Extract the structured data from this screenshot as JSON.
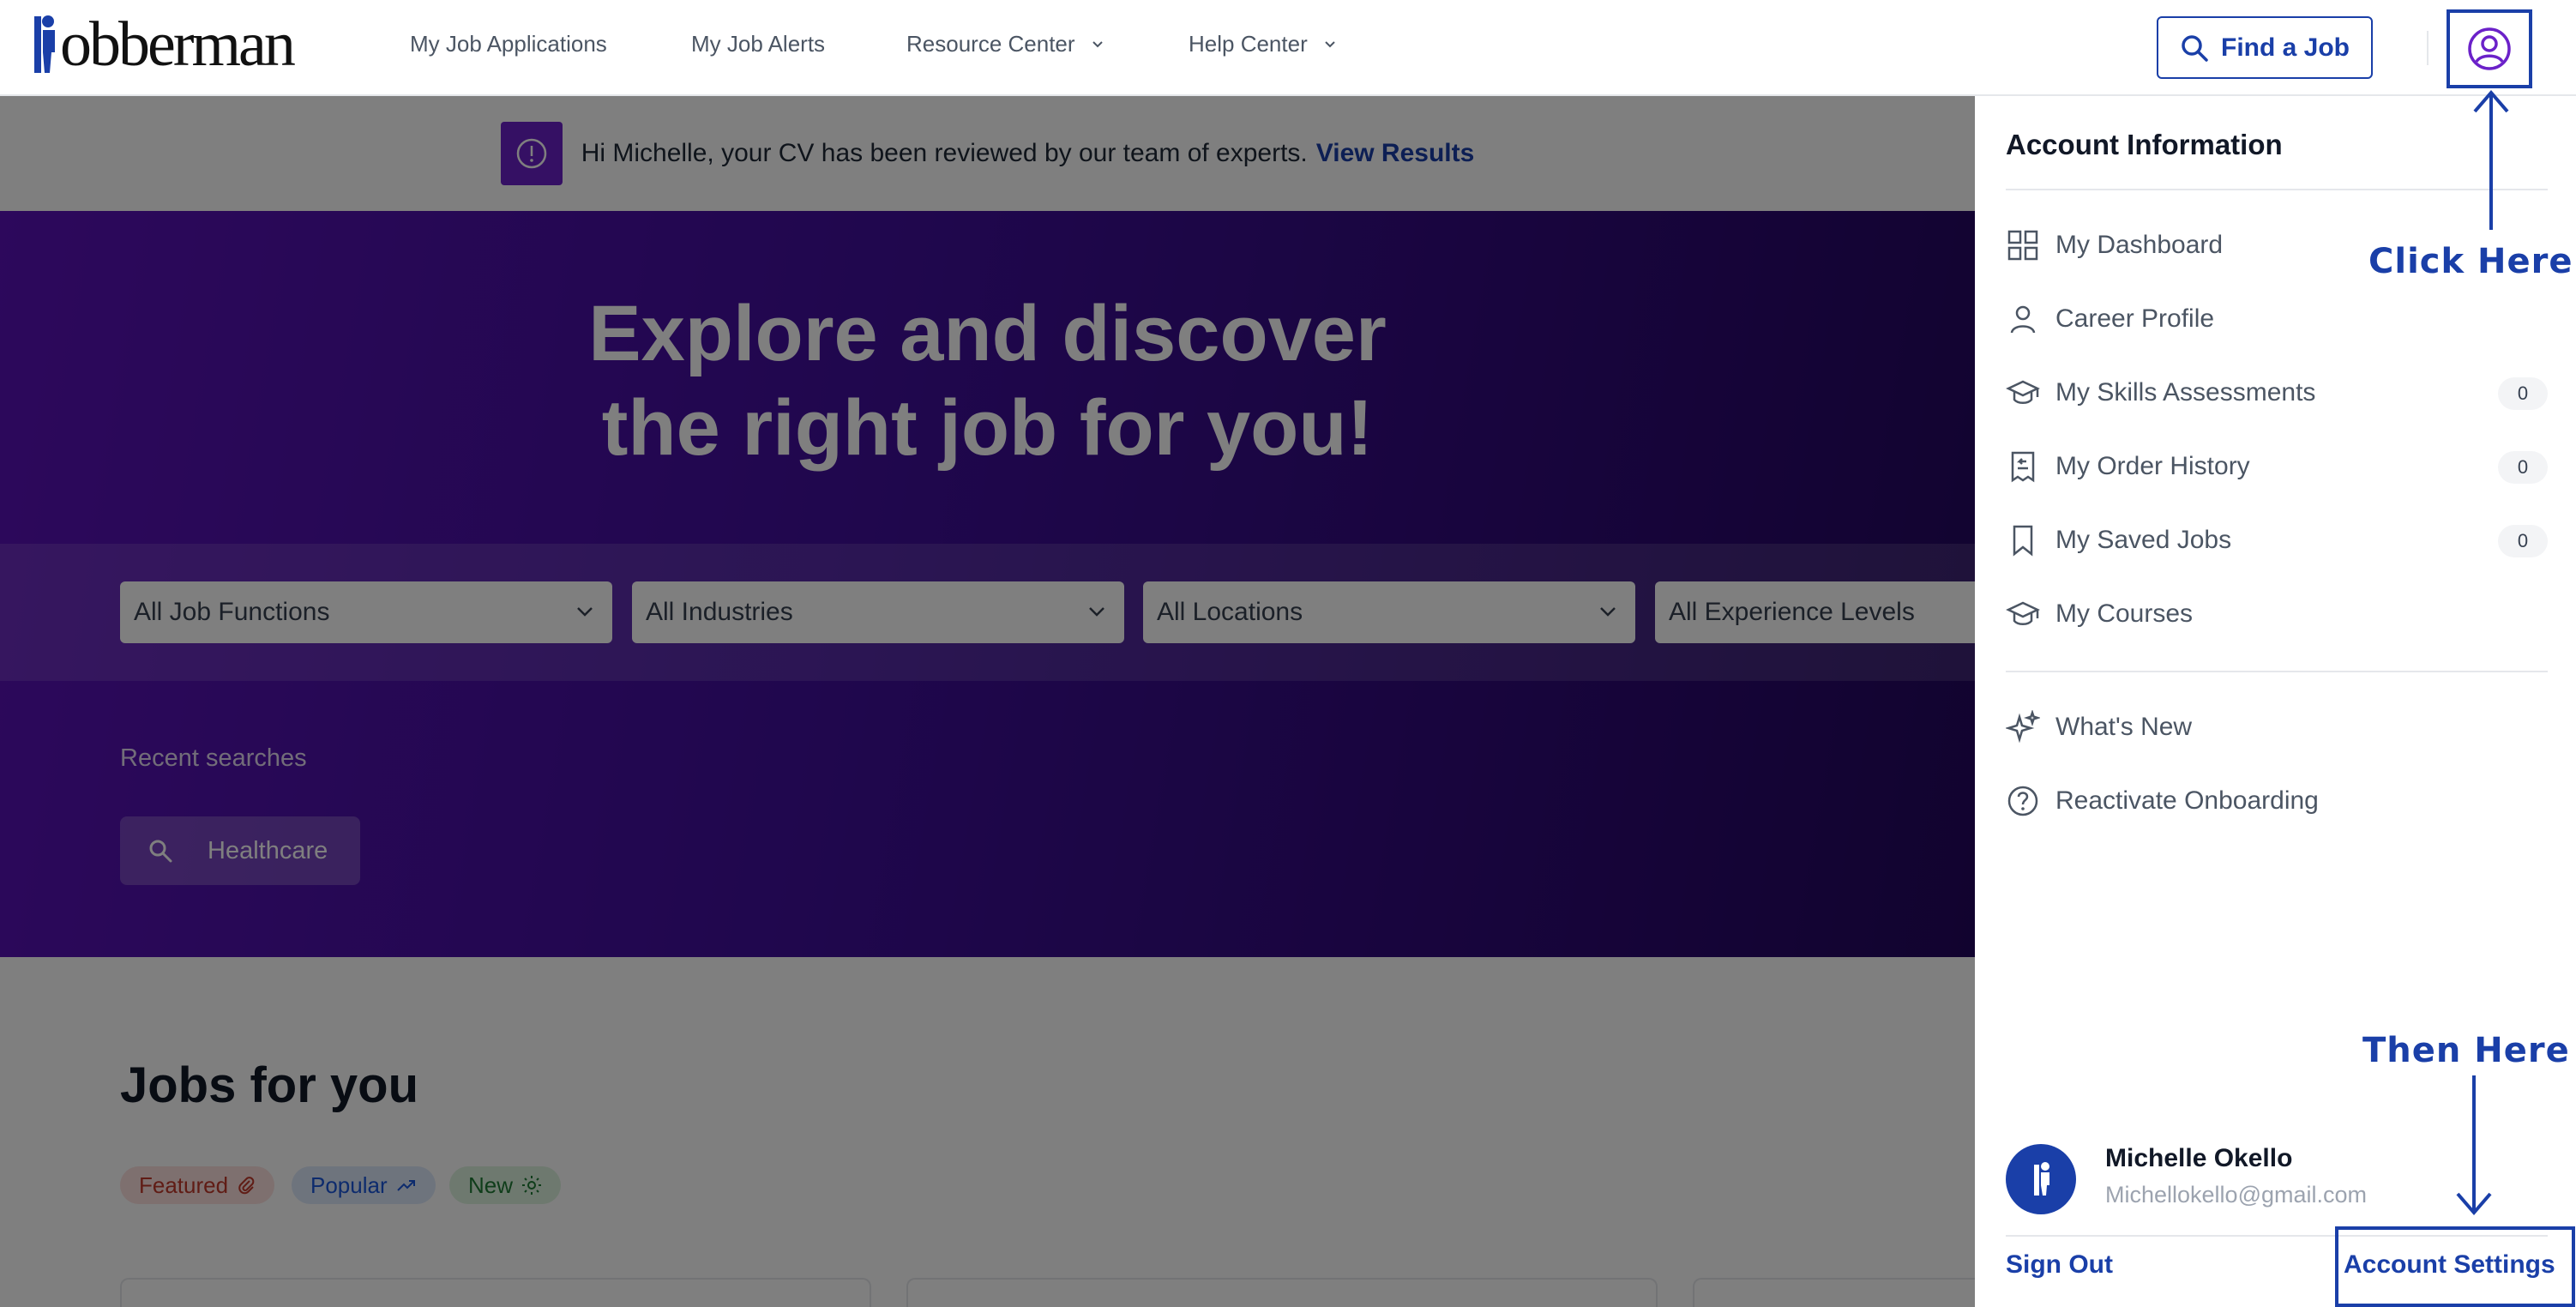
{
  "navbar": {
    "logo_text": "obberman",
    "links": [
      {
        "label": "My Job Applications",
        "has_dropdown": false
      },
      {
        "label": "My Job Alerts",
        "has_dropdown": false
      },
      {
        "label": "Resource Center",
        "has_dropdown": true
      },
      {
        "label": "Help Center",
        "has_dropdown": true
      }
    ],
    "find_job_label": "Find a Job",
    "account_icon": "user-circle-icon"
  },
  "cv_banner": {
    "message": "Hi Michelle, your CV has been reviewed by our team of experts.",
    "link_label": "View Results",
    "icon": "alert-circle-icon"
  },
  "hero": {
    "title_line1": "Explore and discover",
    "title_line2": "the right job for you!",
    "filters": [
      {
        "label": "All Job Functions"
      },
      {
        "label": "All Industries"
      },
      {
        "label": "All Locations"
      },
      {
        "label": "All Experience Levels"
      }
    ],
    "recent_label": "Recent searches",
    "recent_searches": [
      {
        "label": "Healthcare"
      }
    ]
  },
  "jobs": {
    "title": "Jobs for you",
    "tags": [
      {
        "label": "Featured",
        "icon": "paperclip-icon"
      },
      {
        "label": "Popular",
        "icon": "trending-up-icon"
      },
      {
        "label": "New",
        "icon": "sun-icon"
      }
    ]
  },
  "drawer": {
    "title": "Account Information",
    "menu": [
      {
        "label": "My Dashboard",
        "icon": "dashboard-grid-icon",
        "badge": null
      },
      {
        "label": "Career Profile",
        "icon": "person-icon",
        "badge": null
      },
      {
        "label": "My Skills Assessments",
        "icon": "graduation-cap-icon",
        "badge": "0"
      },
      {
        "label": "My Order History",
        "icon": "receipt-icon",
        "badge": "0"
      },
      {
        "label": "My Saved Jobs",
        "icon": "bookmark-icon",
        "badge": "0"
      },
      {
        "label": "My Courses",
        "icon": "graduation-cap-icon",
        "badge": null
      }
    ],
    "secondary_menu": [
      {
        "label": "What's New",
        "icon": "sparkle-icon"
      },
      {
        "label": "Reactivate Onboarding",
        "icon": "help-circle-icon"
      }
    ],
    "user": {
      "name": "Michelle Okello",
      "email": "Michellokello@gmail.com"
    },
    "sign_out_label": "Sign Out",
    "account_settings_label": "Account Settings"
  },
  "annotations": {
    "click_here": "Click Here",
    "then_here": "Then Here"
  },
  "colors": {
    "brand_blue": "#1a3fa8",
    "hero_purple": "#5a11b8",
    "annotation_blue": "#1a3fa8"
  }
}
